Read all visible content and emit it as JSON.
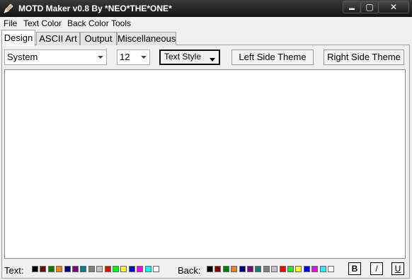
{
  "window": {
    "title": "MOTD Maker v0.8 By *NEO*THE*ONE*",
    "controls": {
      "minimize": "▬",
      "maximize": "▢",
      "close": "✕"
    }
  },
  "menu": [
    "File",
    "Text Color",
    "Back Color",
    "Tools"
  ],
  "tabs": [
    {
      "label": "Design",
      "active": true
    },
    {
      "label": "ASCII Art",
      "active": false
    },
    {
      "label": "Output",
      "active": false
    },
    {
      "label": "Miscellaneous",
      "active": false
    }
  ],
  "toolbar": {
    "font": "System",
    "size": "12",
    "text_style": "Text Style",
    "left_theme": "Left Side Theme",
    "right_theme": "Right Side Theme"
  },
  "editor": {
    "value": ""
  },
  "bottom": {
    "text_label": "Text:",
    "back_label": "Back:",
    "bold": "B",
    "italic": "/",
    "underline": "U",
    "palette": [
      "#000000",
      "#800000",
      "#008000",
      "#ff8000",
      "#000080",
      "#800080",
      "#008080",
      "#808080",
      "#c0c0c0",
      "#ff0000",
      "#00ff00",
      "#ffff00",
      "#0000ff",
      "#ff00ff",
      "#00ffff",
      "#ffffff"
    ]
  }
}
